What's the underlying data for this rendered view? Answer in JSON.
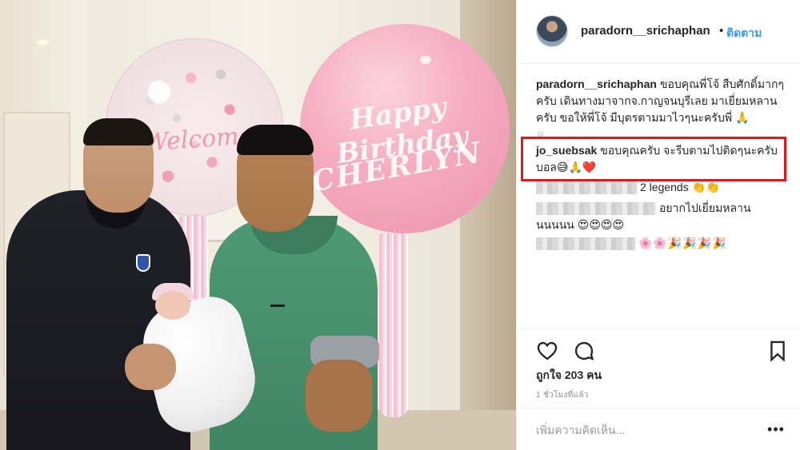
{
  "post": {
    "author": "paradorn__srichaphan",
    "follow_label": "ติดตาม",
    "separator": "•"
  },
  "photo": {
    "balloon_clear_text": "Welcome",
    "balloon_pink_line1": "Happy Birthday",
    "balloon_pink_line2": "CHERLYN"
  },
  "caption": {
    "user": "paradorn__srichaphan",
    "text": "ขอบคุณพี่โจ้ สืบศักดิ์มากๆครับ เดินทางมาจากจ.กาญจนบุรีเลย มาเยี่ยมหลานครับ ขอให้พี่โจ้ มีบุตรตามมาไวๆนะครับพี่ 🙏",
    "trailing_emoji": "☺"
  },
  "comments": [
    {
      "user": "jo_suebsak",
      "text": "ขอบคุณครับ จะรีบตามไปติดๆนะครับบอล😅🙏❤️",
      "highlighted": true
    },
    {
      "user": "",
      "text": "2 legends 👏👏",
      "blurred_user": true
    },
    {
      "user": "",
      "text": "อยากไปเยี่ยมหลานนนนนน 😍😍😍😍",
      "blurred_user": true
    },
    {
      "user": "",
      "text": "🌸🌸🎉🎉🎉🎉",
      "blurred_user": true
    }
  ],
  "actions": {
    "like_icon": "heart-outline",
    "comment_icon": "speech-bubble",
    "save_icon": "bookmark-outline",
    "likes_text": "ถูกใจ 203 คน",
    "timestamp": "1 ชั่วโมงที่แล้ว"
  },
  "composer": {
    "placeholder": "เพิ่มความคิดเห็น...",
    "more_label": "•••"
  },
  "colors": {
    "link_blue": "#3897f0",
    "highlight_red": "#e8141c",
    "text_dark": "#262626",
    "text_muted": "#8e8e8e"
  }
}
